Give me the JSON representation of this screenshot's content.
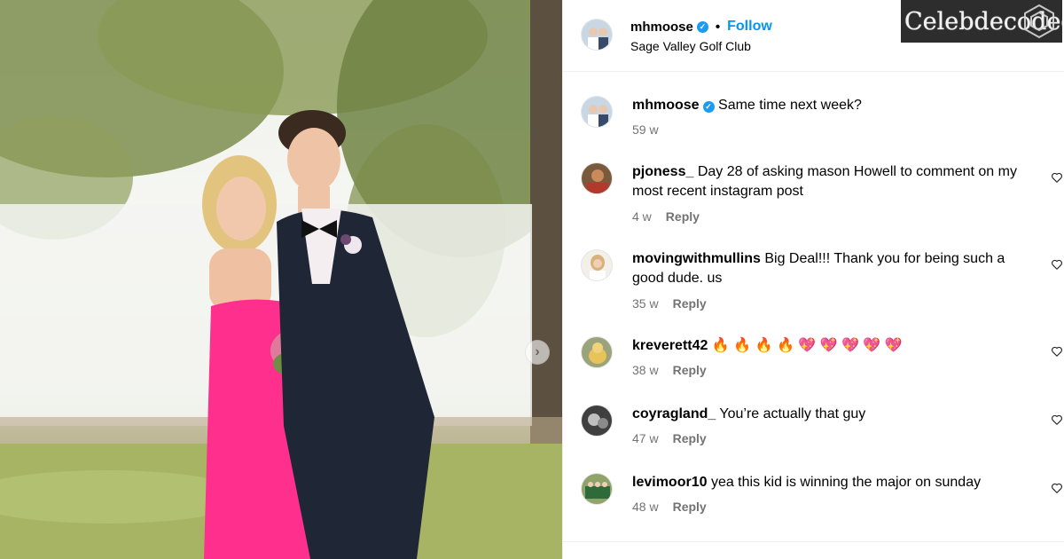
{
  "post": {
    "username": "mhmoose",
    "separator": "•",
    "follow_label": "Follow",
    "location": "Sage Valley Golf Club"
  },
  "watermark": {
    "text": "Celebdecoded"
  },
  "photo": {
    "next_glyph": "›"
  },
  "comments": [
    {
      "user": "mhmoose",
      "verified": true,
      "text": "Same time next week?",
      "time": "59 w",
      "reply": ""
    },
    {
      "user": "pjoness_",
      "verified": false,
      "text": "Day 28 of asking mason Howell to comment on my most recent instagram post",
      "time": "4 w",
      "reply": "Reply"
    },
    {
      "user": "movingwithmullins",
      "verified": false,
      "text": "Big Deal!!! Thank you for being such a good dude. us",
      "time": "35 w",
      "reply": "Reply"
    },
    {
      "user": "kreverett42",
      "verified": false,
      "text": "🔥 🔥 🔥 🔥 💖 💖 💖 💖 💖",
      "time": "38 w",
      "reply": "Reply"
    },
    {
      "user": "coyragland_",
      "verified": false,
      "text": "You’re actually that guy",
      "time": "47 w",
      "reply": "Reply"
    },
    {
      "user": "levimoor10",
      "verified": false,
      "text": "yea this kid is winning the major on sunday",
      "time": "48 w",
      "reply": "Reply"
    }
  ],
  "icons": {
    "verified": "verified-badge-icon",
    "like": "heart-outline-icon",
    "next": "chevron-right-icon"
  },
  "colors": {
    "link_blue": "#0095f6",
    "verified_blue": "#1d9bf0",
    "meta_gray": "#737373"
  }
}
